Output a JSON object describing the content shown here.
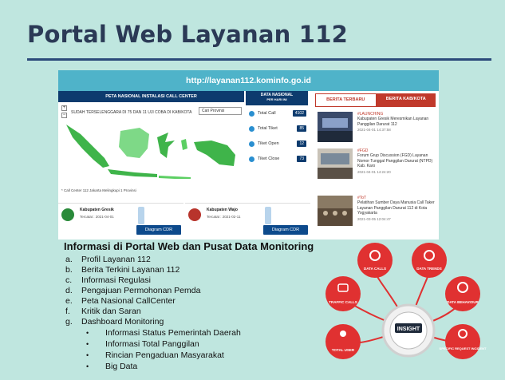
{
  "slide": {
    "title": "Portal Web Layanan 112"
  },
  "portal": {
    "url": "http://layanan112.kominfo.go.id",
    "map": {
      "header": "PETA NASIONAL INSTALASI CALL CENTER",
      "subtitle": "SUDAH TERSELENGGARA DI 75 DAN 11 UJI COBA DI KAB/KOTA",
      "province_placeholder": "Cari Provinsi",
      "zoom_in": "+",
      "zoom_out": "−",
      "footnote": "* Call Center 112 Jakarta Melingkupi 1 Provinsi"
    },
    "stats": {
      "header_line1": "DATA NASIONAL",
      "header_line2": "PER HARI INI",
      "rows": [
        {
          "label": "Total Call",
          "value": "4102"
        },
        {
          "label": "Total Tiket",
          "value": "85"
        },
        {
          "label": "Tiket Open",
          "value": "12"
        },
        {
          "label": "Tiket Close",
          "value": "73"
        }
      ]
    },
    "news": {
      "tabs": [
        "BERITA TERBARU",
        "BERITA KAB/KOTA"
      ],
      "items": [
        {
          "tag": "#LAUNCHING",
          "title": "Kabupaten Gresik Meresmikan Layanan Panggilan Darurat 112",
          "date": "2021-04-01 14:37:58"
        },
        {
          "tag": "#FGD",
          "title": "Forum Grup Discussion (FGD) Layanan Nomor Tunggal Panggilan Darurat (NTPD) Kab. Karo",
          "date": "2021-04-01 14:24:20"
        },
        {
          "tag": "#ToT",
          "title": "Pelatihan Sumber Daya Manusia Call Taker Layanan Panggilan Darurat 112 di Kota Yogyakarta",
          "date": "2021-03-05 12:04:47"
        }
      ]
    },
    "regencies": [
      {
        "name": "Kabupaten Gresik",
        "date": "Tercatat : 2021-04-01",
        "button": "Diagram CDR"
      },
      {
        "name": "Kabupaten Wajo",
        "date": "Tercatat : 2021-02-11",
        "button": "Diagram CDR"
      }
    ]
  },
  "info": {
    "title": "Informasi di Portal Web dan Pusat Data Monitoring",
    "items": [
      {
        "marker": "a.",
        "text": "Profil Layanan 112"
      },
      {
        "marker": "b.",
        "text": "Berita Terkini Layanan 112"
      },
      {
        "marker": "c.",
        "text": "Informasi Regulasi"
      },
      {
        "marker": "d.",
        "text": "Pengajuan Permohonan Pemda"
      },
      {
        "marker": "e.",
        "text": "Peta Nasional CallCenter"
      },
      {
        "marker": "f.",
        "text": "Kritik dan Saran"
      },
      {
        "marker": "g.",
        "text": "Dashboard Monitoring"
      }
    ],
    "subitems": [
      "Informasi Status Pemerintah Daerah",
      "Informasi Total Panggilan",
      "Rincian Pengaduan Masyarakat",
      "Big Data"
    ]
  },
  "insight": {
    "center": "INSIGHT",
    "nodes": [
      "DATA CALLS",
      "DATA TRENDS",
      "TRAFFIC CALLS",
      "DATA BEHAVIOUR",
      "TOTAL USER",
      "SPECIFIC REQUEST INCIDENT"
    ],
    "color": "#e03131"
  }
}
